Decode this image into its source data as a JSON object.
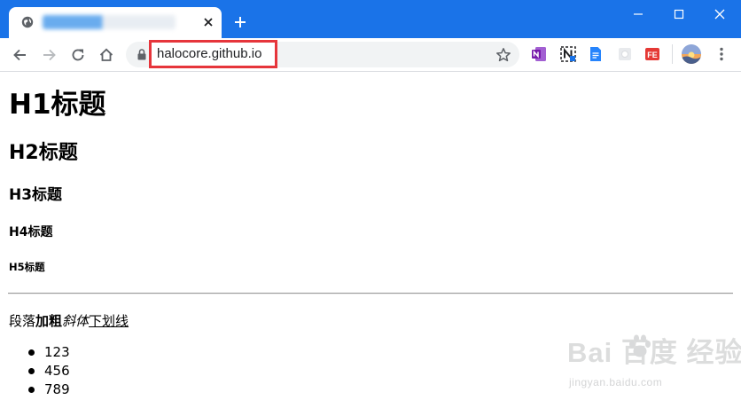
{
  "browser": {
    "tab": {
      "title": "",
      "favicon": "globe-icon"
    },
    "address_bar": {
      "url": "halocore.github.io"
    },
    "colors": {
      "titlebar": "#1a73e8",
      "highlight_box": "#e6353b"
    },
    "extensions": [
      "onenote-icon",
      "notion-icon",
      "docs-icon",
      "grey-extension-icon",
      "fe-helper-icon"
    ]
  },
  "page": {
    "h1": "H1标题",
    "h2": "H2标题",
    "h3": "H3标题",
    "h4": "H4标题",
    "h5": "H5标题",
    "paragraph": {
      "plain": "段落",
      "bold": "加粗",
      "italic": "斜体",
      "underline": "下划线"
    },
    "list": [
      "123",
      "456",
      "789"
    ]
  },
  "watermark": {
    "logo": "Bai  百度 经验",
    "sub": "jingyan.baidu.com"
  }
}
